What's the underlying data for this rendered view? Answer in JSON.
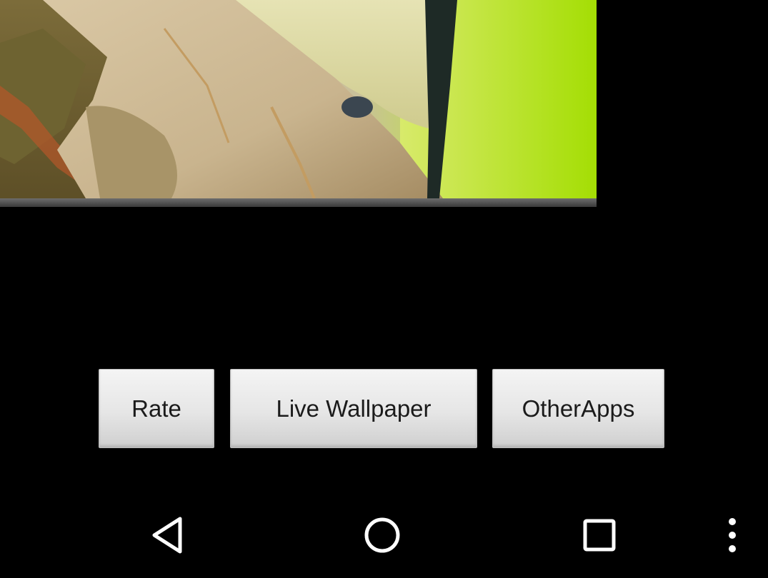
{
  "preview": {
    "description_icon": "wallpaper-preview-image"
  },
  "buttons": {
    "rate_label": "Rate",
    "live_wallpaper_label": "Live Wallpaper",
    "other_apps_label": "OtherApps"
  },
  "navbar": {
    "back_icon": "back-triangle-icon",
    "home_icon": "home-circle-icon",
    "recents_icon": "recents-square-icon",
    "menu_icon": "overflow-menu-icon"
  },
  "colors": {
    "background": "#000000",
    "button_face": "#e6e6e6",
    "button_text": "#1b1b1b",
    "nav_icon": "#ffffff"
  }
}
